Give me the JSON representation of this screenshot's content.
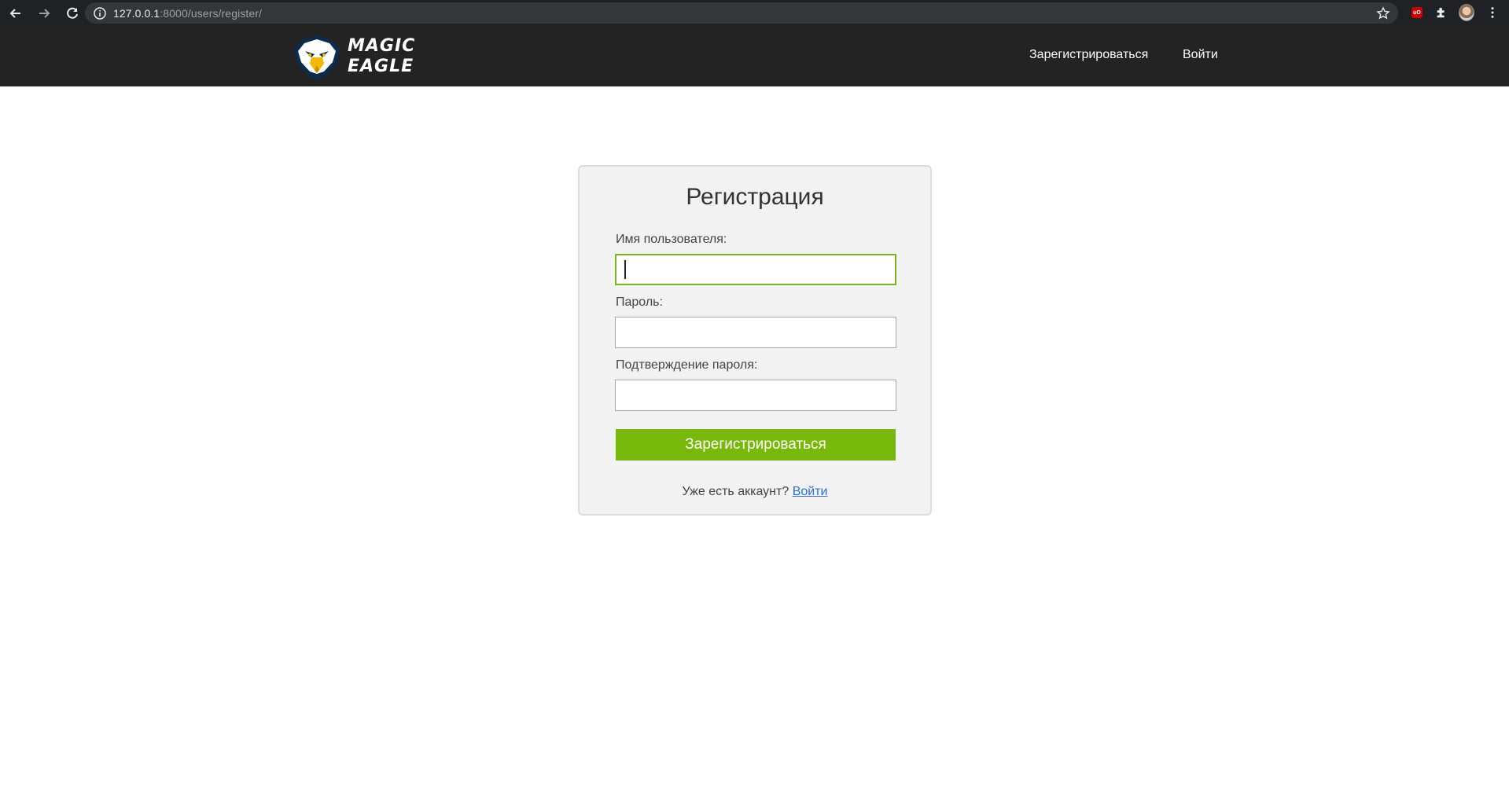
{
  "browser": {
    "url_host": "127.0.0.1",
    "url_rest": ":8000/users/register/"
  },
  "site": {
    "logo_line1": "MAGIC",
    "logo_line2": "EAGLE",
    "nav": {
      "register": "Зарегистрироваться",
      "login": "Войти"
    }
  },
  "form": {
    "title": "Регистрация",
    "username_label": "Имя пользователя:",
    "username_value": "",
    "password_label": "Пароль:",
    "password_value": "",
    "confirm_label": "Подтверждение пароля:",
    "confirm_value": "",
    "submit_label": "Зарегистрироваться",
    "footer_text": "Уже есть аккаунт?",
    "footer_link": "Войти"
  },
  "colors": {
    "accent_green": "#78b80a",
    "header_bg": "#232323",
    "link_blue": "#2a6fd6"
  }
}
